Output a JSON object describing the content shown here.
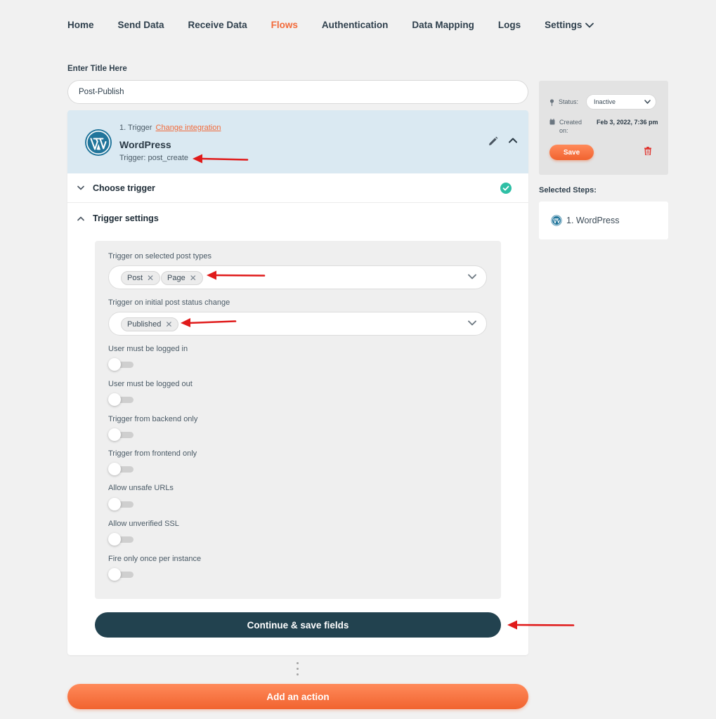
{
  "nav": {
    "items": [
      "Home",
      "Send Data",
      "Receive Data",
      "Flows",
      "Authentication",
      "Data Mapping",
      "Logs"
    ],
    "active": "Flows",
    "settings": "Settings"
  },
  "title": {
    "label": "Enter Title Here",
    "value": "Post-Publish"
  },
  "trigger": {
    "step": "1. Trigger",
    "change_link": "Change integration",
    "integration": "WordPress",
    "code": "Trigger: post_create"
  },
  "sections": {
    "choose": "Choose trigger",
    "settings": "Trigger settings"
  },
  "fields": {
    "post_types_label": "Trigger on selected post types",
    "post_types": [
      "Post",
      "Page"
    ],
    "status_label": "Trigger on initial post status change",
    "status_values": [
      "Published"
    ],
    "toggles": [
      {
        "label": "User must be logged in",
        "on": false
      },
      {
        "label": "User must be logged out",
        "on": false
      },
      {
        "label": "Trigger from backend only",
        "on": false
      },
      {
        "label": "Trigger from frontend only",
        "on": false
      },
      {
        "label": "Allow unsafe URLs",
        "on": false
      },
      {
        "label": "Allow unverified SSL",
        "on": false
      },
      {
        "label": "Fire only once per instance",
        "on": false
      }
    ]
  },
  "buttons": {
    "continue": "Continue & save fields",
    "add_action": "Add an action",
    "save": "Save"
  },
  "side": {
    "status_label": "Status:",
    "status_value": "Inactive",
    "created_label": "Created on:",
    "created_value": "Feb 3, 2022, 7:36 pm",
    "selected_label": "Selected Steps:",
    "step": "1. WordPress"
  },
  "colors": {
    "accent": "#f26a3a",
    "header_bg": "#dae9f2",
    "dark_button": "#22424f",
    "annotation": "#e01b1b"
  }
}
